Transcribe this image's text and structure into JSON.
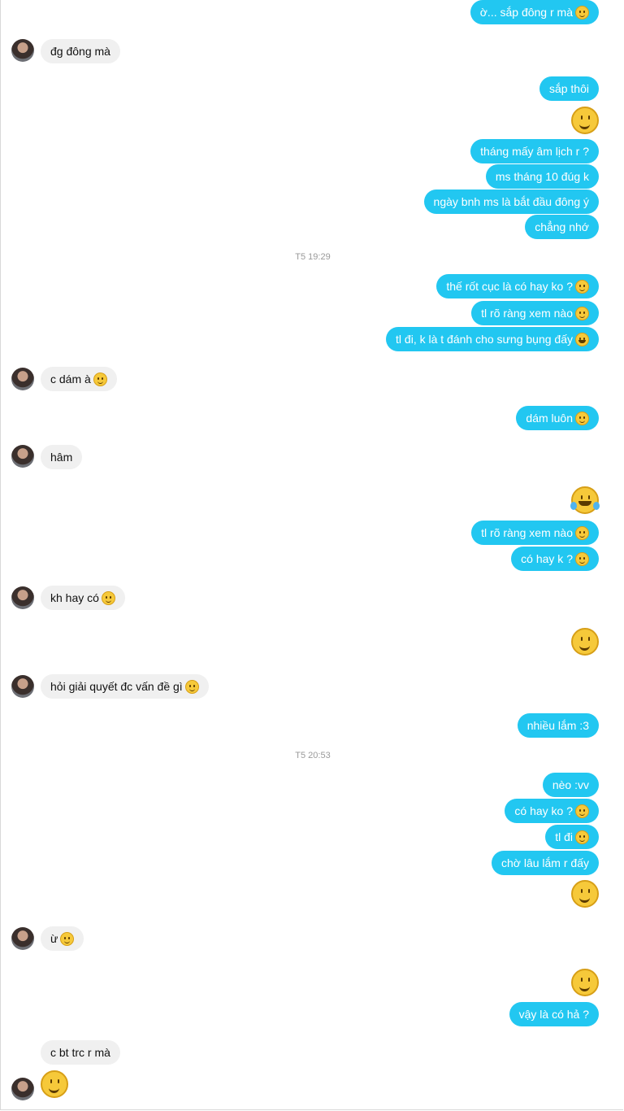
{
  "conversation": {
    "timestamps": [
      "T5 19:29",
      "T5 20:53"
    ],
    "messages": [
      {
        "text": "ờ... sắp đông r mà",
        "emoji": "smile-emoji"
      },
      {
        "text": "đg đông mà"
      },
      {
        "text": "sắp thôi"
      },
      {
        "text": "tháng mấy âm lịch r ?"
      },
      {
        "text": "ms tháng 10 đúg k"
      },
      {
        "text": "ngày bnh ms là bắt đầu đông ý"
      },
      {
        "text": "chẳng nhớ"
      },
      {
        "text": "thế rốt cục là có hay ko ?",
        "emoji": "smile-emoji"
      },
      {
        "text": "tl rõ ràng xem nào",
        "emoji": "smile-emoji"
      },
      {
        "text": "tl đi, k là t đánh cho sưng bụng đấy",
        "emoji": "laugh-emoji"
      },
      {
        "text": "c dám à",
        "emoji": "smile-emoji"
      },
      {
        "text": "dám luôn",
        "emoji": "smile-emoji"
      },
      {
        "text": "hâm"
      },
      {
        "text": "tl rõ ràng xem nào",
        "emoji": "smile-emoji"
      },
      {
        "text": "có hay k ?",
        "emoji": "smile-emoji"
      },
      {
        "text": "kh hay có",
        "emoji": "smile-emoji"
      },
      {
        "text": "hỏi giải quyết đc vấn đề gì",
        "emoji": "smile-emoji"
      },
      {
        "text": "nhiều lắm :3"
      },
      {
        "text": "nèo :vv"
      },
      {
        "text": "có hay ko ?",
        "emoji": "smile-emoji"
      },
      {
        "text": "tl đi",
        "emoji": "smile-emoji"
      },
      {
        "text": "chờ lâu lắm r đấy"
      },
      {
        "text": "ừ",
        "emoji": "smile-emoji"
      },
      {
        "text": "vậy là có hả ?"
      },
      {
        "text": "c bt trc r mà"
      }
    ]
  },
  "colors": {
    "outgoing_bubble": "#22c7f1",
    "incoming_bubble": "#f0f0f0",
    "timestamp": "#9a9a9a"
  }
}
